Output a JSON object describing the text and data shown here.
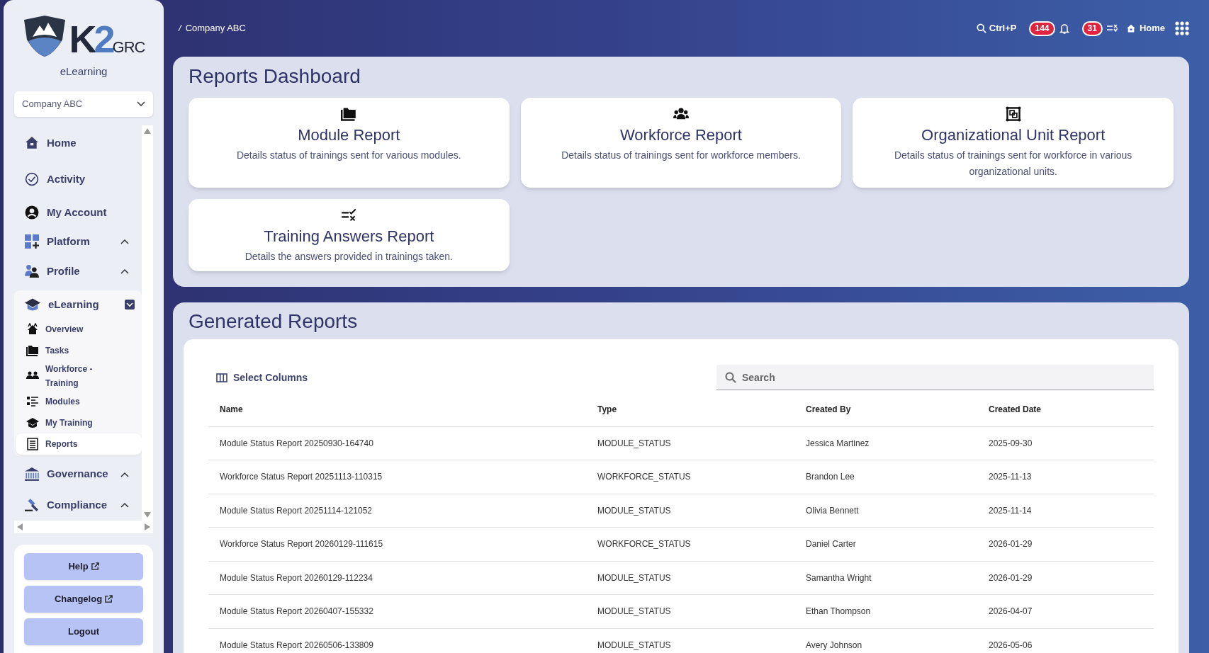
{
  "logo": {
    "wordmark": "K2",
    "suffix": "GRC",
    "product": "eLearning"
  },
  "company_select": {
    "value": "Company ABC"
  },
  "sidebar": {
    "items": [
      {
        "label": "Home",
        "kind": "link",
        "selected": false
      },
      {
        "label": "Activity",
        "kind": "link",
        "selected": false
      },
      {
        "label": "My Account",
        "kind": "link",
        "selected": false
      },
      {
        "label": "Platform",
        "kind": "group",
        "expanded": false,
        "selected": false
      },
      {
        "label": "Profile",
        "kind": "group",
        "expanded": false,
        "selected": false
      },
      {
        "label": "eLearning",
        "kind": "group",
        "expanded": true,
        "selected": false,
        "children": [
          {
            "label": "Overview",
            "selected": false
          },
          {
            "label": "Tasks",
            "selected": false
          },
          {
            "label": "Workforce - Training",
            "selected": false
          },
          {
            "label": "Modules",
            "selected": false
          },
          {
            "label": "My Training",
            "selected": false
          },
          {
            "label": "Reports",
            "selected": true
          }
        ]
      },
      {
        "label": "Governance",
        "kind": "group",
        "expanded": false,
        "selected": false
      },
      {
        "label": "Compliance",
        "kind": "group",
        "expanded": false,
        "selected": false
      }
    ]
  },
  "sidebar_buttons": [
    {
      "label": "Help",
      "external": true
    },
    {
      "label": "Changelog",
      "external": true
    },
    {
      "label": "Logout",
      "external": false
    }
  ],
  "breadcrumb": {
    "separator": "/",
    "label": "Company ABC"
  },
  "header": {
    "search_shortcut": "Ctrl+P",
    "notifications_count": "144",
    "tasks_count": "31",
    "home_label": "Home"
  },
  "reports_dashboard": {
    "title": "Reports Dashboard",
    "cards": [
      {
        "title": "Module Report",
        "description": "Details status of trainings sent for various modules."
      },
      {
        "title": "Workforce Report",
        "description": "Details status of trainings sent for workforce members."
      },
      {
        "title": "Organizational Unit Report",
        "description": "Details status of trainings sent for workforce in various organizational units."
      },
      {
        "title": "Training Answers Report",
        "description": "Details the answers provided in trainings taken."
      }
    ]
  },
  "generated_reports": {
    "title": "Generated Reports",
    "select_columns": "Select Columns",
    "search": {
      "placeholder": "Search"
    },
    "table": {
      "columns": [
        "Name",
        "Type",
        "Created By",
        "Created Date"
      ],
      "rows": [
        [
          "Module Status Report 20250930-164740",
          "MODULE_STATUS",
          "Jessica Martinez",
          "2025-09-30"
        ],
        [
          "Workforce Status Report 20251113-110315",
          "WORKFORCE_STATUS",
          "Brandon Lee",
          "2025-11-13"
        ],
        [
          "Module Status Report 20251114-121052",
          "MODULE_STATUS",
          "Olivia Bennett",
          "2025-11-14"
        ],
        [
          "Workforce Status Report 20260129-111615",
          "WORKFORCE_STATUS",
          "Daniel Carter",
          "2026-01-29"
        ],
        [
          "Module Status Report 20260129-112234",
          "MODULE_STATUS",
          "Samantha Wright",
          "2026-01-29"
        ],
        [
          "Module Status Report 20260407-155332",
          "MODULE_STATUS",
          "Ethan Thompson",
          "2026-04-07"
        ],
        [
          "Module Status Report 20260506-133809",
          "MODULE_STATUS",
          "Avery Johnson",
          "2026-05-06"
        ]
      ]
    }
  }
}
